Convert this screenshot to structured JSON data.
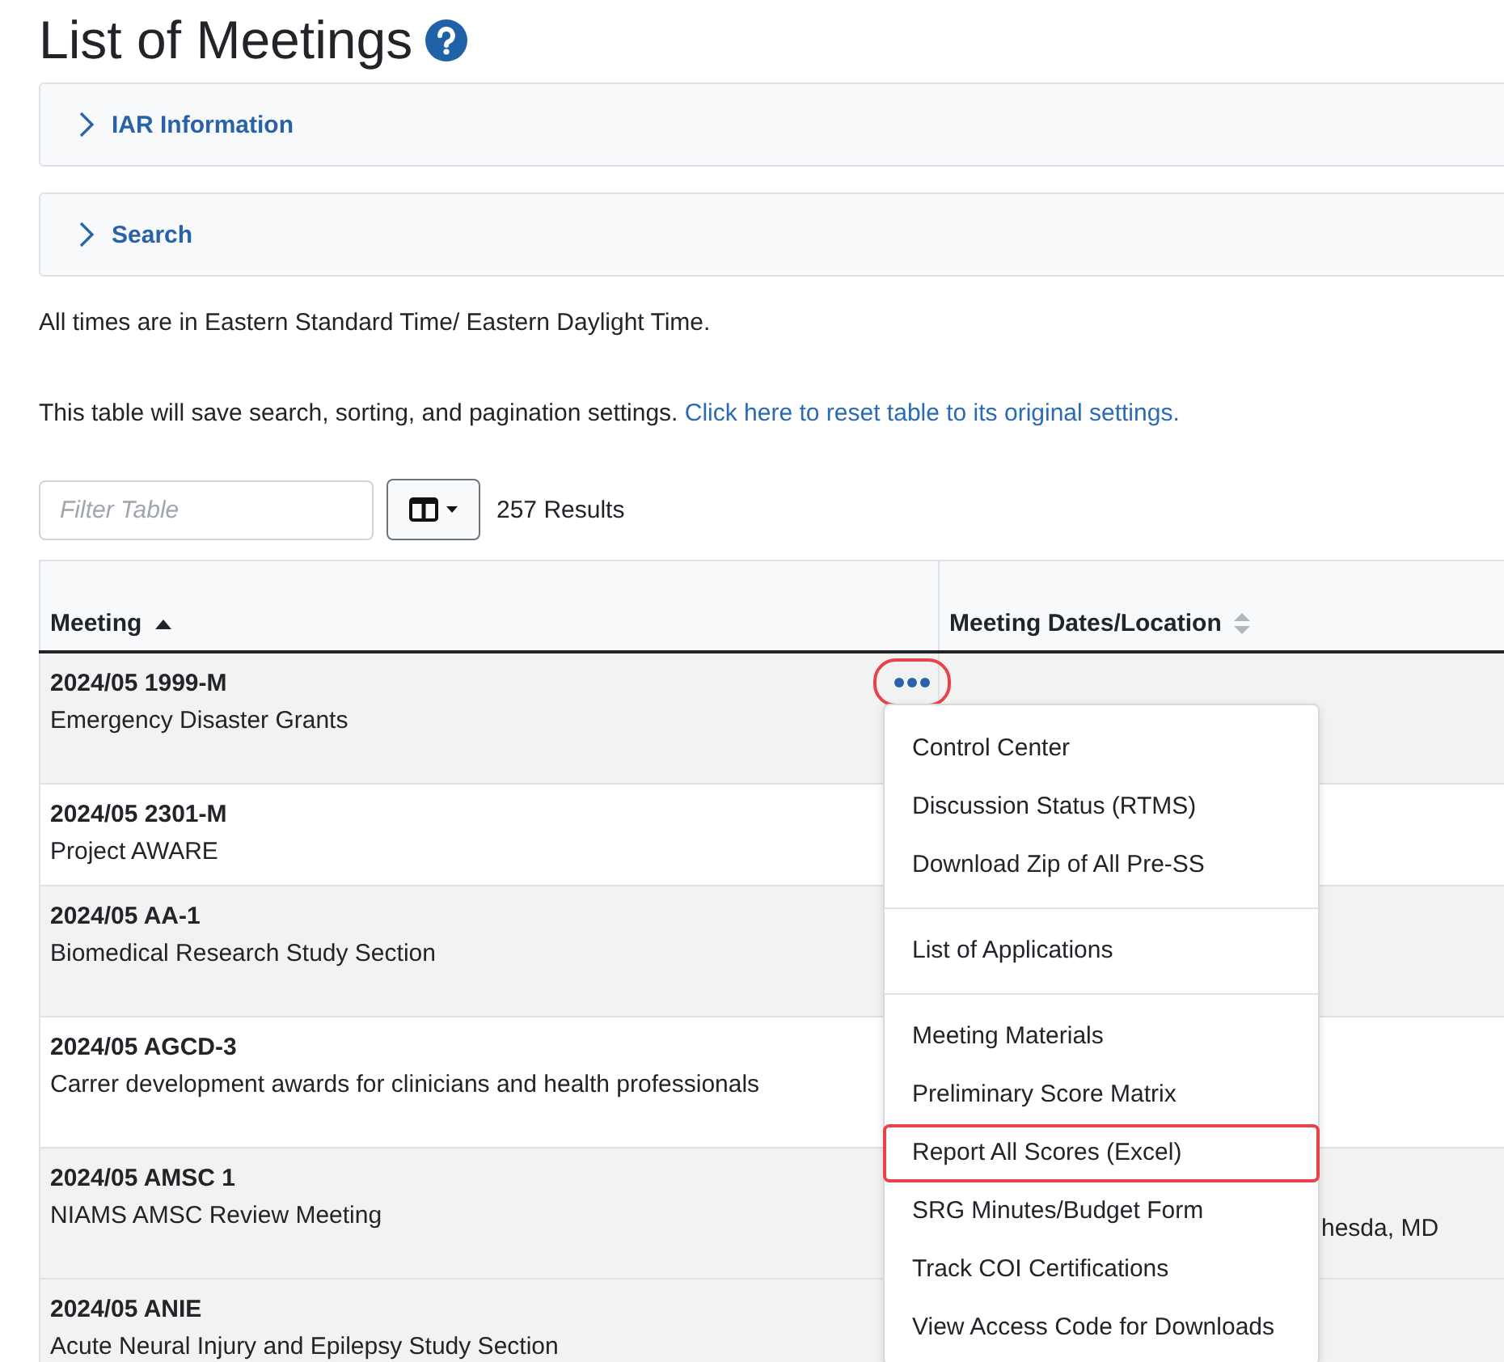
{
  "page": {
    "title": "List of Meetings"
  },
  "panels": [
    {
      "label": "IAR Information",
      "expanded": false
    },
    {
      "label": "Search",
      "expanded": false
    }
  ],
  "notes": [
    {
      "text": "All times are in Eastern Standard Time/ Eastern Daylight Time."
    },
    {
      "text": "This table will save search, sorting, and pagination settings.",
      "link": "Click here to reset table to its original settings."
    }
  ],
  "toolbar": {
    "filter_placeholder": "Filter Table",
    "results": "257 Results"
  },
  "table": {
    "columns": [
      {
        "label": "Meeting",
        "sorted": true
      },
      {
        "label": "Meeting Dates/Location",
        "sorted": false
      }
    ],
    "rows": [
      {
        "code": "2024/05 1999-M",
        "name": "Emergency Disaster Grants",
        "shaded": true,
        "actions": true,
        "highlighted": true,
        "tall": true
      },
      {
        "code": "2024/05 2301-M",
        "name": "Project AWARE",
        "shaded": false,
        "tall": false
      },
      {
        "code": "2024/05 AA-1",
        "name": "Biomedical Research Study Section",
        "shaded": true,
        "tall": true
      },
      {
        "code": "2024/05 AGCD-3",
        "name": "Carrer development awards for clinicians and health professionals",
        "shaded": false,
        "tall": true
      },
      {
        "code": "2024/05 AMSC 1",
        "name": "NIAMS AMSC Review Meeting",
        "shaded": true,
        "tall": true,
        "column_2": "hesda, MD"
      },
      {
        "code": "2024/05 ANIE",
        "name": "Acute Neural Injury and Epilepsy Study Section",
        "shaded": true,
        "tall": true
      }
    ]
  },
  "menu": {
    "groups": [
      [
        {
          "label": "Control Center",
          "highlighted": false
        },
        {
          "label": "Discussion Status (RTMS)",
          "highlighted": false
        },
        {
          "label": "Download Zip of All Pre-SS",
          "highlighted": false
        }
      ],
      [
        {
          "label": "List of Applications",
          "highlighted": false
        }
      ],
      [
        {
          "label": "Meeting Materials",
          "highlighted": false
        },
        {
          "label": "Preliminary Score Matrix",
          "highlighted": false
        },
        {
          "label": "Report All Scores (Excel)",
          "highlighted": true
        },
        {
          "label": "SRG Minutes/Budget Form",
          "highlighted": false
        },
        {
          "label": "Track COI Certifications",
          "highlighted": false
        },
        {
          "label": "View Access Code for Downloads",
          "highlighted": false
        }
      ]
    ]
  }
}
